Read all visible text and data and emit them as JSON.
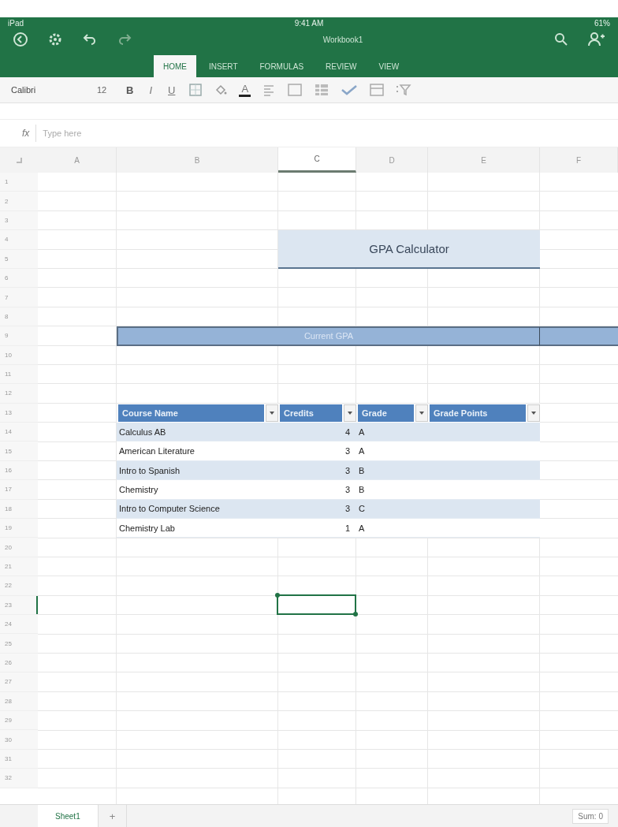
{
  "status_bar": {
    "device": "iPad",
    "time": "9:41 AM",
    "battery": "61%"
  },
  "title": "Workbook1",
  "ribbon_tabs": [
    {
      "label": "HOME",
      "selected": true
    },
    {
      "label": "INSERT",
      "selected": false
    },
    {
      "label": "FORMULAS",
      "selected": false
    },
    {
      "label": "REVIEW",
      "selected": false
    },
    {
      "label": "VIEW",
      "selected": false
    }
  ],
  "toolbar": {
    "font": "Calibri",
    "size": "12",
    "bold": "B",
    "italic": "I",
    "underline": "U",
    "font_color": "A"
  },
  "formula_bar": {
    "label": "fx",
    "placeholder": "Type here"
  },
  "columns": [
    {
      "label": "A",
      "selected": false
    },
    {
      "label": "B",
      "selected": false
    },
    {
      "label": "C",
      "selected": true
    },
    {
      "label": "D",
      "selected": false
    },
    {
      "label": "E",
      "selected": false
    },
    {
      "label": "F",
      "selected": false
    }
  ],
  "rows": [
    {
      "label": "1",
      "selected": false
    },
    {
      "label": "2",
      "selected": false
    },
    {
      "label": "3",
      "selected": false
    },
    {
      "label": "4",
      "selected": false
    },
    {
      "label": "5",
      "selected": false
    },
    {
      "label": "6",
      "selected": false
    },
    {
      "label": "7",
      "selected": false
    },
    {
      "label": "8",
      "selected": false
    },
    {
      "label": "9",
      "selected": false
    },
    {
      "label": "10",
      "selected": false
    },
    {
      "label": "11",
      "selected": false
    },
    {
      "label": "12",
      "selected": false
    },
    {
      "label": "13",
      "selected": false
    },
    {
      "label": "14",
      "selected": false
    },
    {
      "label": "15",
      "selected": false
    },
    {
      "label": "16",
      "selected": false
    },
    {
      "label": "17",
      "selected": false
    },
    {
      "label": "18",
      "selected": false
    },
    {
      "label": "19",
      "selected": false
    },
    {
      "label": "20",
      "selected": false
    },
    {
      "label": "21",
      "selected": false
    },
    {
      "label": "22",
      "selected": false
    },
    {
      "label": "23",
      "selected": true
    },
    {
      "label": "24",
      "selected": false
    },
    {
      "label": "25",
      "selected": false
    },
    {
      "label": "26",
      "selected": false
    },
    {
      "label": "27",
      "selected": false
    },
    {
      "label": "28",
      "selected": false
    },
    {
      "label": "29",
      "selected": false
    },
    {
      "label": "30",
      "selected": false
    },
    {
      "label": "31",
      "selected": false
    },
    {
      "label": "32",
      "selected": false
    }
  ],
  "title_block": "GPA Calculator",
  "gpa_band": "Current GPA",
  "table": {
    "columns": [
      "Course Name",
      "Credits",
      "Grade",
      "Grade Points"
    ],
    "rows": [
      {
        "course": "Calculus AB",
        "credits": "4",
        "grade": "A"
      },
      {
        "course": "American Literature",
        "credits": "3",
        "grade": "A"
      },
      {
        "course": "Intro to Spanish",
        "credits": "3",
        "grade": "B"
      },
      {
        "course": "Chemistry",
        "credits": "3",
        "grade": "B"
      },
      {
        "course": "Intro to Computer Science",
        "credits": "3",
        "grade": "C"
      },
      {
        "course": "Chemistry Lab",
        "credits": "1",
        "grade": "A"
      }
    ]
  },
  "sheet_tabs": [
    {
      "label": "Sheet1",
      "selected": true
    }
  ],
  "add_sheet": "+",
  "sum": "Sum: 0"
}
